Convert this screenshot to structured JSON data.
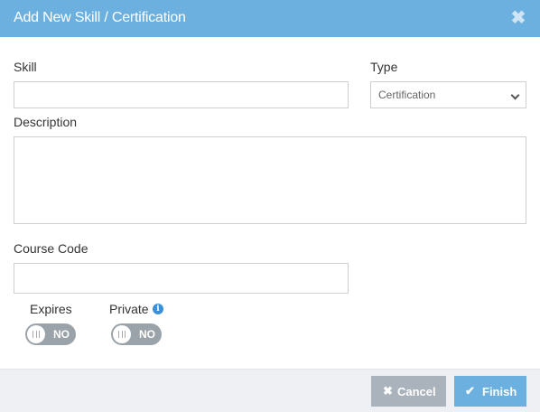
{
  "dialog": {
    "title": "Add New Skill / Certification",
    "close_icon": "close-icon"
  },
  "form": {
    "skill": {
      "label": "Skill",
      "value": ""
    },
    "type": {
      "label": "Type",
      "selected": "Certification"
    },
    "description": {
      "label": "Description",
      "value": ""
    },
    "course_code": {
      "label": "Course Code",
      "value": ""
    },
    "expires": {
      "label": "Expires",
      "state": "NO"
    },
    "private": {
      "label": "Private",
      "state": "NO",
      "info_icon": "info-icon"
    }
  },
  "footer": {
    "cancel_label": "Cancel",
    "finish_label": "Finish"
  },
  "colors": {
    "header": "#6cb0e0",
    "cancel": "#aab2bb",
    "finish": "#6cb0e0",
    "toggle_off": "#9aa3a9",
    "footer_bg": "#eef0f4"
  }
}
